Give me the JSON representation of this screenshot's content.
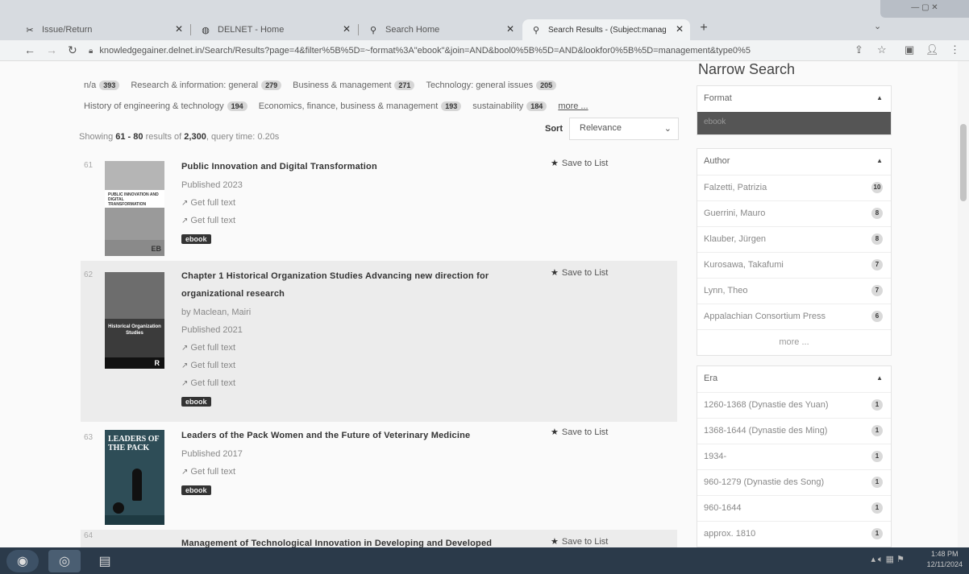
{
  "browser": {
    "tabs": [
      {
        "title": "Issue/Return",
        "icon": "app-icon"
      },
      {
        "title": "DELNET - Home",
        "icon": "globe-icon"
      },
      {
        "title": "Search Home",
        "icon": "search-icon"
      },
      {
        "title": "Search Results - (Subject:manag",
        "icon": "search-icon"
      }
    ],
    "url": "knowledgegainer.delnet.in/Search/Results?page=4&filter%5B%5D=~format%3A\"ebook\"&join=AND&bool0%5B%5D=AND&lookfor0%5B%5D=management&type0%5"
  },
  "facets": {
    "row1": [
      {
        "label": "n/a",
        "count": "393"
      },
      {
        "label": "Research & information: general",
        "count": "279"
      },
      {
        "label": "Business & management",
        "count": "271"
      },
      {
        "label": "Technology: general issues",
        "count": "205"
      }
    ],
    "row2": [
      {
        "label": "History of engineering & technology",
        "count": "194"
      },
      {
        "label": "Economics, finance, business & management",
        "count": "193"
      },
      {
        "label": "sustainability",
        "count": "184"
      }
    ],
    "more_label": "more ..."
  },
  "results_summary": {
    "showing_prefix": "Showing",
    "range": "61 - 80",
    "middle": "results of",
    "total": "2,300",
    "query_time": "query time: 0.20s"
  },
  "sort": {
    "label": "Sort",
    "value": "Relevance"
  },
  "results": [
    {
      "num": "61",
      "title": "Public Innovation and Digital Transformation",
      "published": "Published 2023",
      "links": [
        "Get full text",
        "Get full text"
      ],
      "format": "ebook",
      "save": "Save to List",
      "cover_text": "PUBLIC INNOVATION AND DIGITAL TRANSFORMATION",
      "cover_sub": "EB"
    },
    {
      "num": "62",
      "title_line1": "Chapter 1 Historical Organization Studies Advancing new direction for",
      "title_line2": "organizational research",
      "author": "by Maclean, Mairi",
      "published": "Published 2021",
      "links": [
        "Get full text",
        "Get full text",
        "Get full text"
      ],
      "format": "ebook",
      "save": "Save to List",
      "cover_text": "Historical Organization Studies",
      "cover_sub": "R"
    },
    {
      "num": "63",
      "title": "Leaders of the Pack Women and the Future of Veterinary Medicine",
      "published": "Published 2017",
      "links": [
        "Get full text"
      ],
      "format": "ebook",
      "save": "Save to List",
      "cover_text": "LEADERS OF THE PACK"
    },
    {
      "num": "64",
      "title": "Management of Technological Innovation in Developing and Developed",
      "save": "Save to List"
    }
  ],
  "sidebar": {
    "title": "Narrow Search",
    "format": {
      "header": "Format",
      "selected": "ebook"
    },
    "author": {
      "header": "Author",
      "items": [
        {
          "label": "Falzetti, Patrizia",
          "count": "10"
        },
        {
          "label": "Guerrini, Mauro",
          "count": "8"
        },
        {
          "label": "Klauber, Jürgen",
          "count": "8"
        },
        {
          "label": "Kurosawa, Takafumi",
          "count": "7"
        },
        {
          "label": "Lynn, Theo",
          "count": "7"
        },
        {
          "label": "Appalachian Consortium Press",
          "count": "6"
        }
      ],
      "more": "more ..."
    },
    "era": {
      "header": "Era",
      "items": [
        {
          "label": "1260-1368 (Dynastie des Yuan)",
          "count": "1"
        },
        {
          "label": "1368-1644 (Dynastie des Ming)",
          "count": "1"
        },
        {
          "label": "1934-",
          "count": "1"
        },
        {
          "label": "960-1279 (Dynastie des Song)",
          "count": "1"
        },
        {
          "label": "960-1644",
          "count": "1"
        },
        {
          "label": "approx. 1810",
          "count": "1"
        }
      ]
    }
  },
  "taskbar": {
    "time": "1:48 PM",
    "date": "12/11/2024"
  },
  "colors": {
    "taskbar": "#2b3a4a",
    "ebook_badge": "#333333",
    "format_bar": "#555555"
  }
}
